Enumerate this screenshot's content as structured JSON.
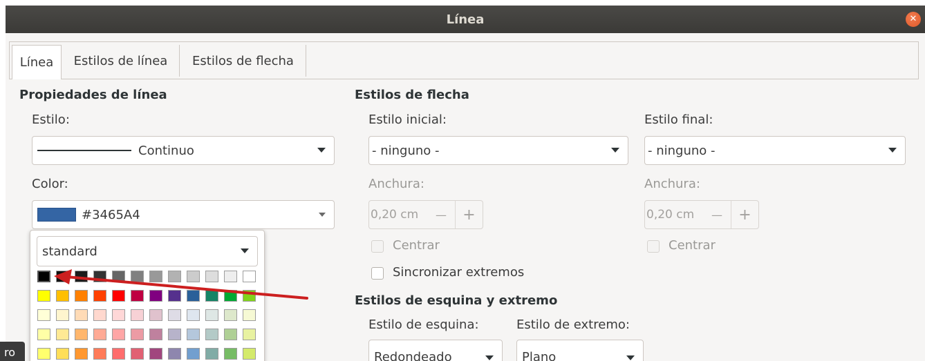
{
  "window": {
    "title": "Línea",
    "close_icon": "close-icon"
  },
  "tabs": [
    {
      "label": "Línea",
      "active": true
    },
    {
      "label": "Estilos de línea",
      "active": false
    },
    {
      "label": "Estilos de flecha",
      "active": false
    }
  ],
  "line_props": {
    "title": "Propiedades de línea",
    "style_label": "Estilo:",
    "style_value": "Continuo",
    "color_label": "Color:",
    "color_value": "#3465A4",
    "color_hex": "#3465A4"
  },
  "palette": {
    "selector_value": "standard",
    "rows": [
      [
        "#000000",
        "#111111",
        "#1c1c1c",
        "#333333",
        "#666666",
        "#808080",
        "#999999",
        "#b2b2b2",
        "#cccccc",
        "#dddddd",
        "#eeeeee",
        "#ffffff"
      ],
      [
        "#ffff00",
        "#ffbf00",
        "#ff8000",
        "#ff4000",
        "#ff0000",
        "#bf0041",
        "#800080",
        "#55308d",
        "#2a6099",
        "#158466",
        "#00a933",
        "#81d41a"
      ],
      [
        "#ffffd7",
        "#fff5ce",
        "#ffdbb6",
        "#ffd8ce",
        "#ffd7d7",
        "#f7d1d5",
        "#e0c2cd",
        "#dedce6",
        "#dee6ef",
        "#dee7e5",
        "#dde8cb",
        "#f6f9d4"
      ],
      [
        "#ffffa6",
        "#ffe994",
        "#ffb66c",
        "#ffaa95",
        "#ffa6a6",
        "#ec9ba4",
        "#bf819e",
        "#b7b3ca",
        "#b4c7dc",
        "#b3cac7",
        "#afd095",
        "#e8f2a1"
      ],
      [
        "#ffff6d",
        "#ffde59",
        "#ff972f",
        "#ff7b59",
        "#ff6d6d",
        "#e16173",
        "#a1467e",
        "#8e86ae",
        "#729fcf",
        "#81aca6",
        "#77bc65",
        "#d4ea6b"
      ]
    ]
  },
  "arrow_styles": {
    "title": "Estilos de flecha",
    "start_label": "Estilo inicial:",
    "start_value": "- ninguno -",
    "end_label": "Estilo final:",
    "end_value": "- ninguno -",
    "width_label_start": "Anchura:",
    "width_label_end": "Anchura:",
    "width_value_start": "0,20 cm",
    "width_value_end": "0,20 cm",
    "minus": "—",
    "plus": "+",
    "center_start": "Centrar",
    "center_end": "Centrar",
    "sync": "Sincronizar extremos"
  },
  "corner_cap": {
    "title": "Estilos de esquina y extremo",
    "corner_label": "Estilo de esquina:",
    "corner_value": "Redondeado",
    "cap_label": "Estilo de extremo:",
    "cap_value": "Plano"
  },
  "bottom_chip": "ro",
  "annotation": {
    "color": "#cc1f1f"
  }
}
